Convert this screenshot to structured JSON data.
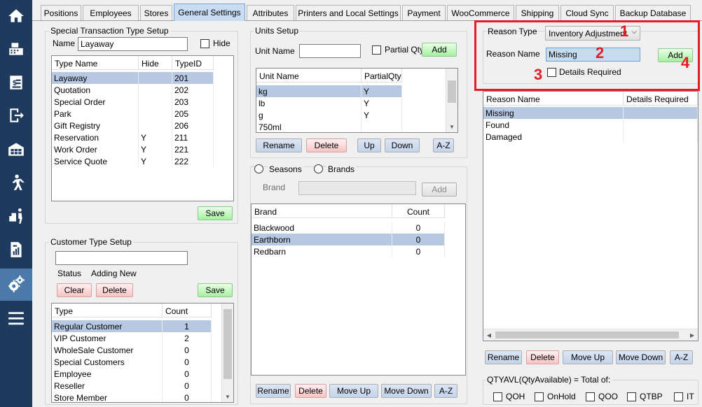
{
  "sidebar": {
    "items": [
      "home-icon",
      "register-icon",
      "invoice-icon",
      "exit-icon",
      "inventory-icon",
      "customer-walk-icon",
      "delivery-icon",
      "report-icon",
      "settings-icon",
      "menu-icon"
    ]
  },
  "tabs": [
    "Positions",
    "Employees",
    "Stores",
    "General Settings",
    "Attributes",
    "Printers and Local Settings",
    "Payment",
    "WooCommerce",
    "Shipping",
    "Cloud Sync",
    "Backup Database"
  ],
  "active_tab": "General Settings",
  "special_tx": {
    "title": "Special Transaction Type Setup",
    "name_label": "Name",
    "name_value": "Layaway",
    "hide_label": "Hide",
    "headers": [
      "Type Name",
      "Hide",
      "TypeID"
    ],
    "rows": [
      [
        "Layaway",
        "",
        "201"
      ],
      [
        "Quotation",
        "",
        "202"
      ],
      [
        "Special Order",
        "",
        "203"
      ],
      [
        "Park",
        "",
        "205"
      ],
      [
        "Gift Registry",
        "",
        "206"
      ],
      [
        "Reservation",
        "Y",
        "211"
      ],
      [
        "Work Order",
        "Y",
        "221"
      ],
      [
        "Service Quote",
        "Y",
        "222"
      ]
    ],
    "save": "Save"
  },
  "customer_type": {
    "title": "Customer Type Setup",
    "name_value": "",
    "status_label": "Status",
    "status_value": "Adding New",
    "clear": "Clear",
    "delete": "Delete",
    "save": "Save",
    "headers": [
      "Type",
      "Count"
    ],
    "rows": [
      [
        "Regular Customer",
        "1"
      ],
      [
        "VIP Customer",
        "2"
      ],
      [
        "WholeSale Customer",
        "0"
      ],
      [
        "Special Customers",
        "0"
      ],
      [
        "Employee",
        "0"
      ],
      [
        "Reseller",
        "0"
      ],
      [
        "Store Member",
        "0"
      ]
    ]
  },
  "units": {
    "title": "Units Setup",
    "unit_name_label": "Unit Name",
    "unit_name_value": "",
    "partial_label": "Partial Qty",
    "add": "Add",
    "headers": [
      "Unit Name",
      "PartialQty"
    ],
    "rows": [
      [
        "kg",
        "Y"
      ],
      [
        "lb",
        "Y"
      ],
      [
        "g",
        "Y"
      ],
      [
        "750ml",
        ""
      ]
    ],
    "rename": "Rename",
    "delete": "Delete",
    "up": "Up",
    "down": "Down",
    "az": "A-Z"
  },
  "brands": {
    "seasons_label": "Seasons",
    "brands_label": "Brands",
    "brand_label": "Brand",
    "brand_value": "",
    "add": "Add",
    "headers": [
      "Brand",
      "Count"
    ],
    "rows": [
      [
        "Blackwood",
        "0"
      ],
      [
        "Earthborn",
        "0"
      ],
      [
        "Redbarn",
        "0"
      ]
    ],
    "rename": "Rename",
    "delete": "Delete",
    "move_up": "Move Up",
    "move_down": "Move Down",
    "az": "A-Z"
  },
  "reason": {
    "type_label": "Reason Type",
    "type_value": "Inventory Adjustment",
    "name_label": "Reason Name",
    "name_value": "Missing",
    "add": "Add",
    "details_label": "Details Required",
    "headers": [
      "Reason Name",
      "Details Required"
    ],
    "rows": [
      [
        "Missing",
        ""
      ],
      [
        "Found",
        ""
      ],
      [
        "Damaged",
        ""
      ]
    ],
    "rename": "Rename",
    "delete": "Delete",
    "move_up": "Move Up",
    "move_down": "Move Down",
    "az": "A-Z",
    "annotations": [
      "1",
      "2",
      "3",
      "4"
    ]
  },
  "qtyavl": {
    "title": "QTYAVL(QtyAvailable) = Total of:",
    "options": [
      "QOH",
      "OnHold",
      "QOO",
      "QTBP",
      "IT"
    ]
  },
  "colors": {
    "sidebar": "#1e3b5e",
    "sidebar_active": "#4a79aa",
    "annotation": "#e01e24",
    "selection": "#b6c8e2"
  }
}
